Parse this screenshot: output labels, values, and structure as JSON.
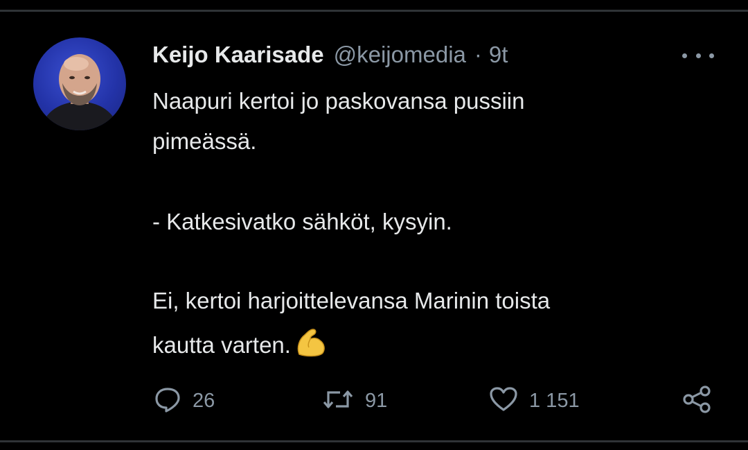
{
  "tweet": {
    "author_name": "Keijo Kaarisade",
    "handle": "@keijomedia",
    "separator": "·",
    "time": "9t",
    "lines": [
      "Naapuri kertoi jo paskovansa pussiin",
      "pimeässä.",
      "- Katkesivatko sähköt, kysyin.",
      "Ei, kertoi harjoittelevansa Marinin toista",
      "kautta varten."
    ],
    "emoji": "flexed-biceps-emoji"
  },
  "actions": {
    "replies": "26",
    "retweets": "91",
    "likes": "1 151"
  },
  "icons": {
    "more": "more-options-icon",
    "reply": "reply-icon",
    "retweet": "retweet-icon",
    "like": "heart-icon",
    "share": "share-icon"
  },
  "colors": {
    "background": "#000000",
    "text": "#e7e9ea",
    "muted": "#8b98a5",
    "divider": "#2f3336",
    "avatar_bg": "#2a3ac0",
    "emoji": "#f4c542"
  }
}
